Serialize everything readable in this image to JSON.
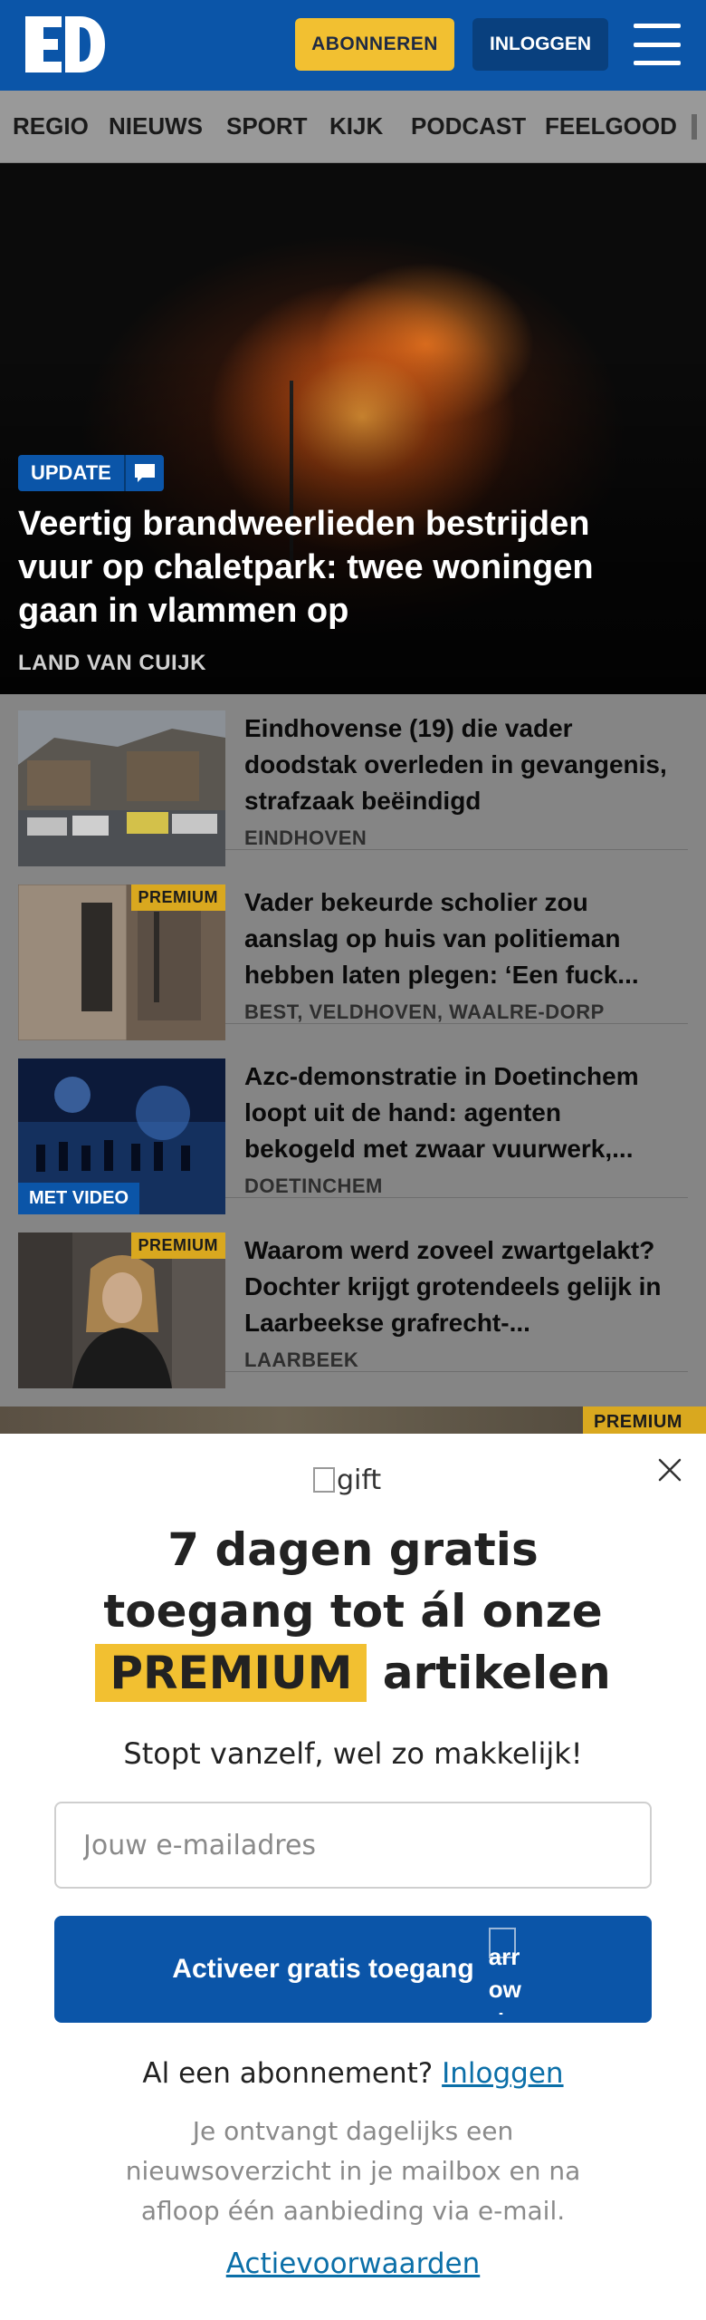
{
  "header": {
    "logo_text": "ED",
    "subscribe_label": "ABONNEREN",
    "login_label": "INLOGGEN"
  },
  "nav": {
    "items": [
      "REGIO",
      "NIEUWS",
      "SPORT",
      "KIJK",
      "PODCAST",
      "FEELGOOD"
    ]
  },
  "hero": {
    "badge": "UPDATE",
    "title": "Veertig brandweerlieden bestrijden vuur op chaletpark: twee woningen gaan in vlammen op",
    "location": "LAND VAN CUIJK"
  },
  "articles": [
    {
      "title": "Eindhovense (19) die vader doodstak overleden in gevangenis, strafzaak beëindigd",
      "location": "EINDHOVEN",
      "badge": ""
    },
    {
      "title": "Vader bekeurde scholier zou aanslag op huis van politieman hebben laten plegen: ‘Een fuck...",
      "location": "BEST, VELDHOVEN, WAALRE-DORP",
      "badge": "PREMIUM"
    },
    {
      "title": "Azc-demonstratie in Doetinchem loopt uit de hand: agenten bekogeld met zwaar vuurwerk,...",
      "location": "DOETINCHEM",
      "badge": "MET VIDEO"
    },
    {
      "title": "Waarom werd zoveel zwartgelakt? Dochter krijgt grotendeels gelijk in Laarbeekse grafrecht-...",
      "location": "LAARBEEK",
      "badge": "PREMIUM"
    }
  ],
  "teaser": {
    "badge": "PREMIUM"
  },
  "modal": {
    "gift_alt": "gift",
    "title_line1": "7 dagen gratis",
    "title_line2": "toegang tot ál onze",
    "title_highlight": "PREMIUM",
    "title_line3_rest": "artikelen",
    "subtitle": "Stopt vanzelf, wel zo makkelijk!",
    "email_placeholder": "Jouw e-mailadres",
    "email_value": "",
    "cta_label": "Activeer gratis toegang",
    "cta_icon_alt": "arrow right",
    "have_sub_text": "Al een abonnement?",
    "have_sub_link": "Inloggen",
    "disclaimer": "Je ontvangt dagelijks een nieuwsoverzicht in je mailbox en na afloop één aanbieding via e-mail.",
    "terms_link": "Actievoorwaarden"
  },
  "colors": {
    "brand_blue": "#0b55a8",
    "accent_yellow": "#f2c031",
    "link_blue": "#0b6fa8"
  }
}
